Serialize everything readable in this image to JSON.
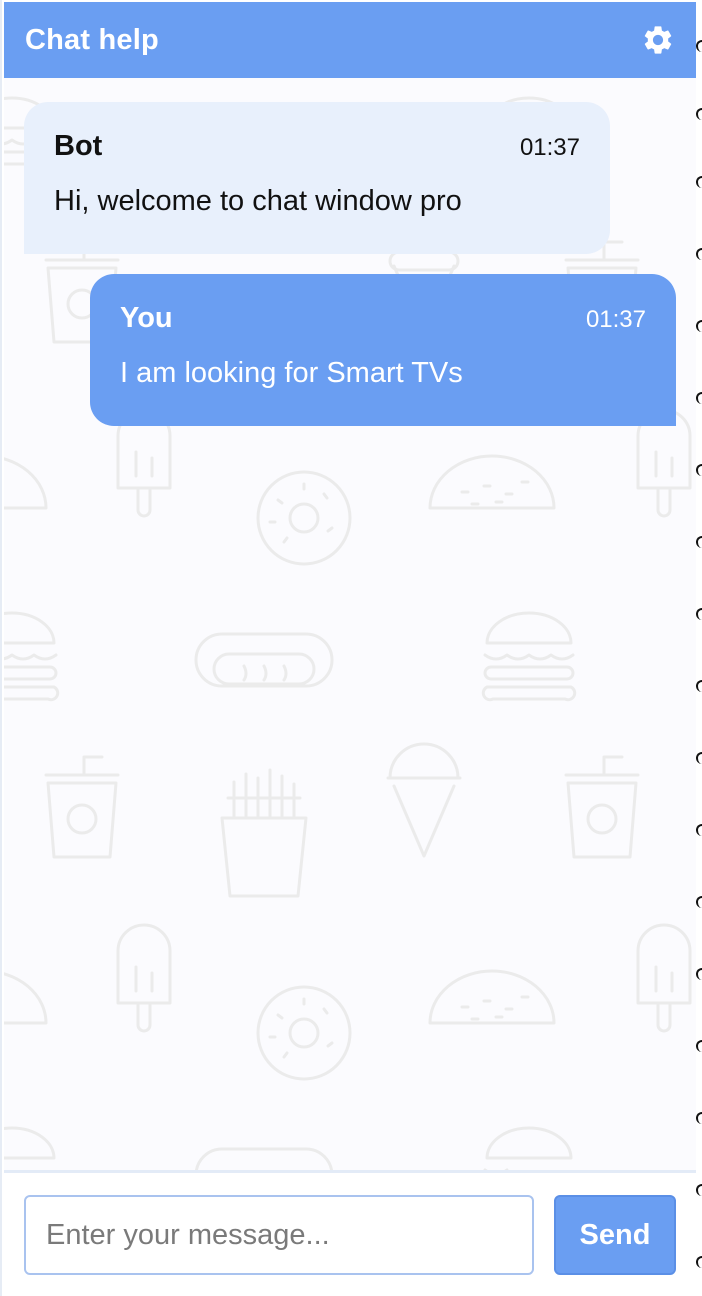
{
  "header": {
    "title": "Chat help",
    "settings_icon": "gear-icon"
  },
  "messages": [
    {
      "sender": "Bot",
      "time": "01:37",
      "text": "Hi, welcome to chat window pro"
    },
    {
      "sender": "You",
      "time": "01:37",
      "text": "I am looking for Smart TVs"
    }
  ],
  "composer": {
    "placeholder": "Enter your message...",
    "value": "",
    "send_label": "Send"
  },
  "background_pattern_icons": [
    "burger-icon",
    "soda-cup-icon",
    "popsicle-icon",
    "taco-icon",
    "donut-icon",
    "hotdog-icon",
    "ice-cream-cone-icon",
    "fries-icon"
  ],
  "colors": {
    "accent": "#6a9ef2",
    "bot_bubble": "#e8f0fc",
    "background": "#fbfbfe"
  }
}
